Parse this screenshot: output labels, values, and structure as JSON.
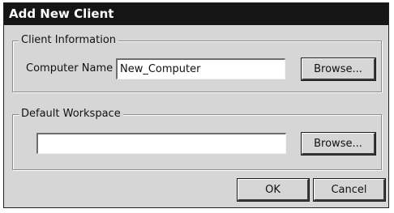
{
  "dialog": {
    "title": "Add New Client"
  },
  "client_info": {
    "legend": "Client Information",
    "computer_name_label": "Computer Name",
    "computer_name_value": "New_Computer",
    "browse_label": "Browse..."
  },
  "default_workspace": {
    "legend": "Default Workspace",
    "workspace_value": "",
    "browse_label": "Browse..."
  },
  "footer": {
    "ok_label": "OK",
    "cancel_label": "Cancel"
  }
}
